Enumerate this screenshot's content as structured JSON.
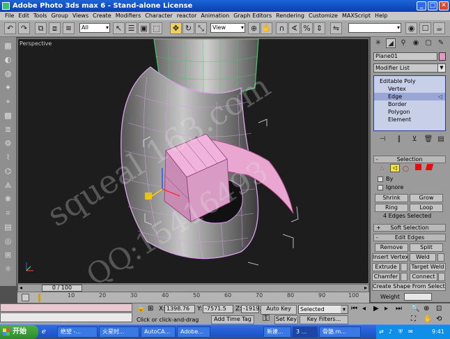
{
  "window": {
    "title": "Adobe Photo 3ds max 6 - Stand-alone License",
    "controls": {
      "minimize": "_",
      "maximize": "□",
      "close": "✕"
    }
  },
  "menu": [
    "File",
    "Edit",
    "Tools",
    "Group",
    "Views",
    "Create",
    "Modifiers",
    "Character",
    "reactor",
    "Animation",
    "Graph Editors",
    "Rendering",
    "Customize",
    "MAXScript",
    "Help"
  ],
  "toolbar": {
    "selection_filter": "All",
    "reference_coord": "View"
  },
  "viewport": {
    "label": "Perspective",
    "watermark_text": "squeal 163.com",
    "watermark_qq": "QQ:15416493"
  },
  "command_panel": {
    "object_name": "Plane01",
    "modifier_list_label": "Modifier List",
    "stack": [
      "Editable Poly",
      "Vertex",
      "Edge",
      "Border",
      "Polygon",
      "Element"
    ],
    "selected_stack_item": "Edge",
    "selection_rollout": {
      "title": "Selection",
      "by_label": "By",
      "ignore_label": "Ignore",
      "shrink": "Shrink",
      "grow": "Grow",
      "ring": "Ring",
      "loop": "Loop",
      "status": "4 Edges Selected"
    },
    "soft_selection_title": "Soft Selection",
    "edit_edges": {
      "title": "Edit Edges",
      "remove": "Remove",
      "split": "Split",
      "insert_vertex": "Insert Vertex",
      "weld": "Weld",
      "extrude": "Extrude",
      "target_weld": "Target Weld",
      "chamfer": "Chamfer",
      "connect": "Connect",
      "create_shape": "Create Shape From Selection"
    },
    "weight_label": "Weight"
  },
  "timeline": {
    "slider_text": "0 / 100",
    "ticks": [
      "10",
      "20",
      "30",
      "40",
      "50",
      "60",
      "70",
      "80",
      "90",
      "100"
    ]
  },
  "status": {
    "prompt": "Click or click-and-drag",
    "add_time_tag": "Add Time Tag",
    "x_label": "X:",
    "x_value": "1398.76",
    "y_label": "Y:",
    "y_value": "-7571.5",
    "z_label": "Z:",
    "z_value": "-1919.",
    "auto_key": "Auto Key",
    "set_key": "Set Key",
    "key_mode": "Selected",
    "key_filters": "Key Filters..."
  },
  "taskbar": {
    "start": "开始",
    "tasks": [
      "绝望 -...",
      "火星时...",
      "AutoCA...",
      "Adobe...",
      "新建...",
      "3 ...",
      "骨骼.m..."
    ],
    "clock": "9:41"
  },
  "colors": {
    "object_color": "#e894c4",
    "max_listener": "#e9c9cf",
    "xp_blue": "#245edb"
  }
}
